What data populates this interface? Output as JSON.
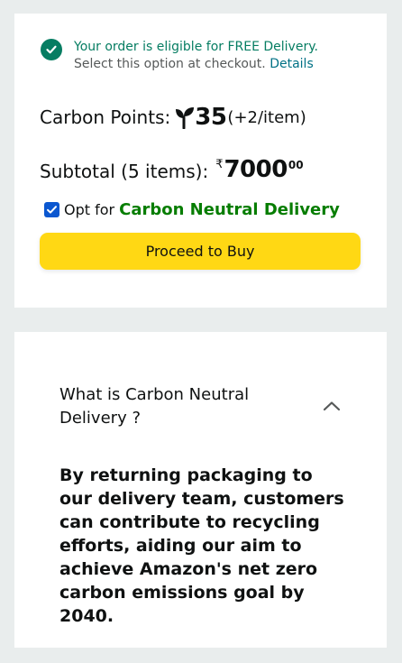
{
  "eligibility": {
    "headline": "Your order is eligible for FREE Delivery.",
    "subtext": "Select this option at checkout.",
    "details_link": "Details"
  },
  "carbon_points": {
    "label": "Carbon Points:",
    "value": "35",
    "per_item": "(+2/item)"
  },
  "subtotal": {
    "label": "Subtotal (5 items):",
    "currency": "₹",
    "whole": "7000",
    "fraction": "00"
  },
  "opt_in": {
    "checked": true,
    "prefix": "Opt for",
    "link_text": "Carbon Neutral Delivery"
  },
  "buy_button": {
    "label": "Proceed to Buy"
  },
  "faq": {
    "question": "What is Carbon Neutral Delivery ?",
    "expanded": true,
    "answer": "By returning packaging to our delivery team, customers can contribute to recycling efforts, aiding our aim to achieve Amazon's net zero carbon emissions goal by 2040."
  },
  "colors": {
    "page_bg": "#e9eded",
    "success_green": "#067d62",
    "link_teal": "#007185",
    "carbon_green": "#067d00",
    "button_yellow": "#ffd814",
    "checkbox_blue": "#0b57d0"
  }
}
